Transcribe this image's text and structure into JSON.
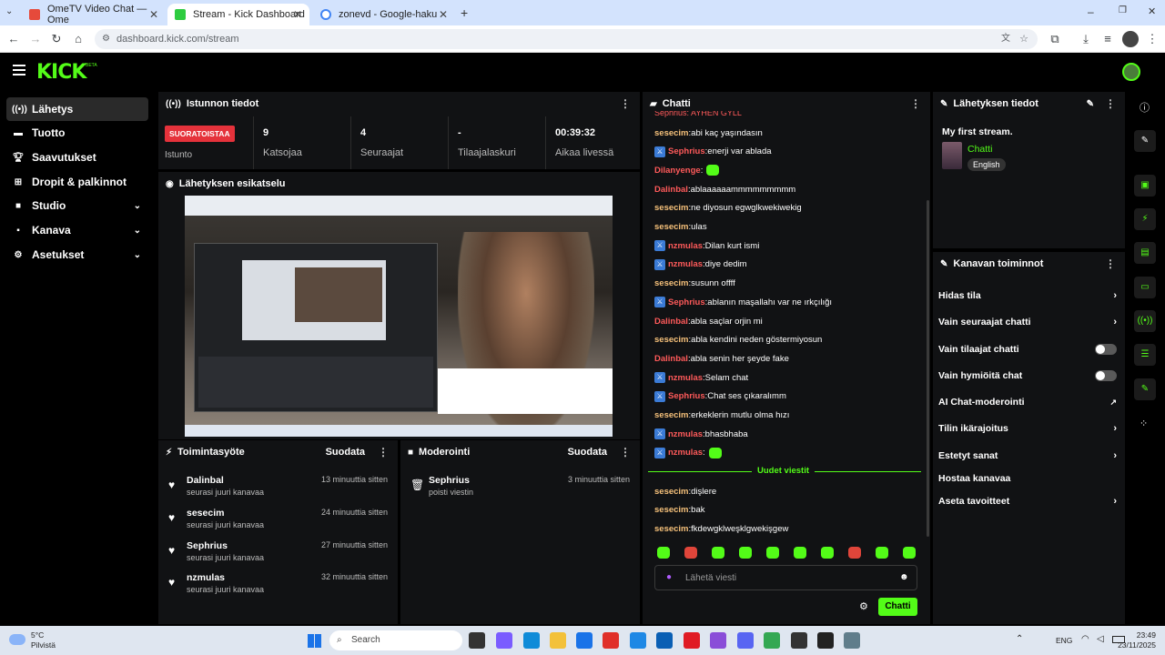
{
  "browser": {
    "tabs": [
      {
        "label": "OmeTV Video Chat — Ome",
        "color": "#e64a3b"
      },
      {
        "label": "Stream - Kick Dashboard",
        "color": "#2ecc40"
      },
      {
        "label": "zonevd - Google-haku",
        "color": "#4285f4"
      }
    ],
    "url": "dashboard.kick.com/stream"
  },
  "kick": {
    "logo": "KICK",
    "beta": "BETA"
  },
  "sidebar": {
    "items": [
      {
        "label": "Lähetys",
        "icon": "broadcast-icon"
      },
      {
        "label": "Tuotto",
        "icon": "money-icon"
      },
      {
        "label": "Saavutukset",
        "icon": "trophy-icon"
      },
      {
        "label": "Dropit & palkinnot",
        "icon": "gift-icon"
      },
      {
        "label": "Studio",
        "icon": "camera-icon"
      },
      {
        "label": "Kanava",
        "icon": "channel-icon"
      },
      {
        "label": "Asetukset",
        "icon": "gear-icon"
      }
    ]
  },
  "session": {
    "title": "Istunnon tiedot",
    "status": "SUORATOISTAA",
    "status_label": "Istunto",
    "stats": [
      {
        "value": "9",
        "label": "Katsojaa"
      },
      {
        "value": "4",
        "label": "Seuraajat"
      },
      {
        "value": "-",
        "label": "Tilaajalaskuri"
      },
      {
        "value": "00:39:32",
        "label": "Aikaa livessä"
      }
    ]
  },
  "preview": {
    "title": "Lähetyksen esikatselu"
  },
  "activity": {
    "title": "Toimintasyöte",
    "filter": "Suodata",
    "items": [
      {
        "name": "Dalinbal",
        "sub": "seurasi juuri kanavaa",
        "time": "13 minuuttia sitten"
      },
      {
        "name": "sesecim",
        "sub": "seurasi juuri kanavaa",
        "time": "24 minuuttia sitten"
      },
      {
        "name": "Sephrius",
        "sub": "seurasi juuri kanavaa",
        "time": "27 minuuttia sitten"
      },
      {
        "name": "nzmulas",
        "sub": "seurasi juuri kanavaa",
        "time": "32 minuuttia sitten"
      }
    ]
  },
  "moderation": {
    "title": "Moderointi",
    "filter": "Suodata",
    "items": [
      {
        "name": "Sephrius",
        "sub": "poisti viestin",
        "time": "3 minuuttia sitten"
      }
    ]
  },
  "chat": {
    "title": "Chatti",
    "partial_top": "Sephrius: AYHEN GYLL",
    "messages": [
      {
        "user": "sesecim",
        "color": "#f5c07a",
        "badge": false,
        "text": "abi kaç yaşındasın"
      },
      {
        "user": "Sephrius",
        "color": "#ff5a5a",
        "badge": true,
        "text": "enerji var ablada"
      },
      {
        "user": "Dilanyenge",
        "color": "#ff5a5a",
        "badge": false,
        "text": "",
        "emote": true
      },
      {
        "user": "Dalinbal",
        "color": "#ff5a5a",
        "badge": false,
        "text": "ablaaaaaammmmmmmmm"
      },
      {
        "user": "sesecim",
        "color": "#f5c07a",
        "badge": false,
        "text": "ne diyosun egwglkwekiwekig"
      },
      {
        "user": "sesecim",
        "color": "#f5c07a",
        "badge": false,
        "text": "ulas"
      },
      {
        "user": "nzmulas",
        "color": "#ff5a5a",
        "badge": true,
        "text": "Dilan kurt ismi"
      },
      {
        "user": "nzmulas",
        "color": "#ff5a5a",
        "badge": true,
        "text": "diye dedim"
      },
      {
        "user": "sesecim",
        "color": "#f5c07a",
        "badge": false,
        "text": "susunn offff"
      },
      {
        "user": "Sephrius",
        "color": "#ff5a5a",
        "badge": true,
        "text": "ablanın maşallahı var ne ırkçılığı"
      },
      {
        "user": "Dalinbal",
        "color": "#ff5a5a",
        "badge": false,
        "text": "abla saçlar orjin mi"
      },
      {
        "user": "sesecim",
        "color": "#f5c07a",
        "badge": false,
        "text": "abla kendini neden göstermiyosun"
      },
      {
        "user": "Dalinbal",
        "color": "#ff5a5a",
        "badge": false,
        "text": "abla senin her şeyde fake"
      },
      {
        "user": "nzmulas",
        "color": "#ff5a5a",
        "badge": true,
        "text": "Selam chat"
      },
      {
        "user": "Sephrius",
        "color": "#ff5a5a",
        "badge": true,
        "text": "Chat ses çıkaralımm"
      },
      {
        "user": "sesecim",
        "color": "#f5c07a",
        "badge": false,
        "text": "erkeklerin mutlu olma hızı"
      },
      {
        "user": "nzmulas",
        "color": "#ff5a5a",
        "badge": true,
        "text": "bhasbhaba"
      },
      {
        "user": "nzmulas",
        "color": "#ff5a5a",
        "badge": true,
        "text": "",
        "emote": true
      }
    ],
    "new_label": "Uudet viestit",
    "new_messages": [
      {
        "user": "sesecim",
        "color": "#f5c07a",
        "text": "dişlere"
      },
      {
        "user": "sesecim",
        "color": "#f5c07a",
        "text": "bak"
      },
      {
        "user": "sesecim",
        "color": "#f5c07a",
        "text": "fkdewgklweşklgwekişgew"
      }
    ],
    "input_placeholder": "Lähetä viesti",
    "send_label": "Chatti"
  },
  "stream_info": {
    "title": "Lähetyksen tiedot",
    "stream_title": "My first stream.",
    "category": "Chatti",
    "language": "English"
  },
  "channel_actions": {
    "title": "Kanavan toiminnot",
    "items": [
      {
        "label": "Hidas tila",
        "control": "chevron"
      },
      {
        "label": "Vain seuraajat chatti",
        "control": "chevron"
      },
      {
        "label": "Vain tilaajat chatti",
        "control": "toggle"
      },
      {
        "label": "Vain hymiöitä chat",
        "control": "toggle"
      },
      {
        "label": "AI Chat-moderointi",
        "control": "external"
      },
      {
        "label": "Tilin ikärajoitus",
        "control": "chevron"
      },
      {
        "label": "Estetyt sanat",
        "control": "chevron"
      },
      {
        "label": "Hostaa kanavaa",
        "control": "none"
      },
      {
        "label": "Aseta tavoitteet",
        "control": "chevron"
      }
    ]
  },
  "taskbar": {
    "weather_temp": "5°C",
    "weather_desc": "Pilvistä",
    "search": "Search",
    "lang": "ENG",
    "time": "23:49",
    "date": "23/11/2025"
  },
  "colors": {
    "accent": "#53fc18",
    "panel": "#111214",
    "live": "#e5323b"
  }
}
